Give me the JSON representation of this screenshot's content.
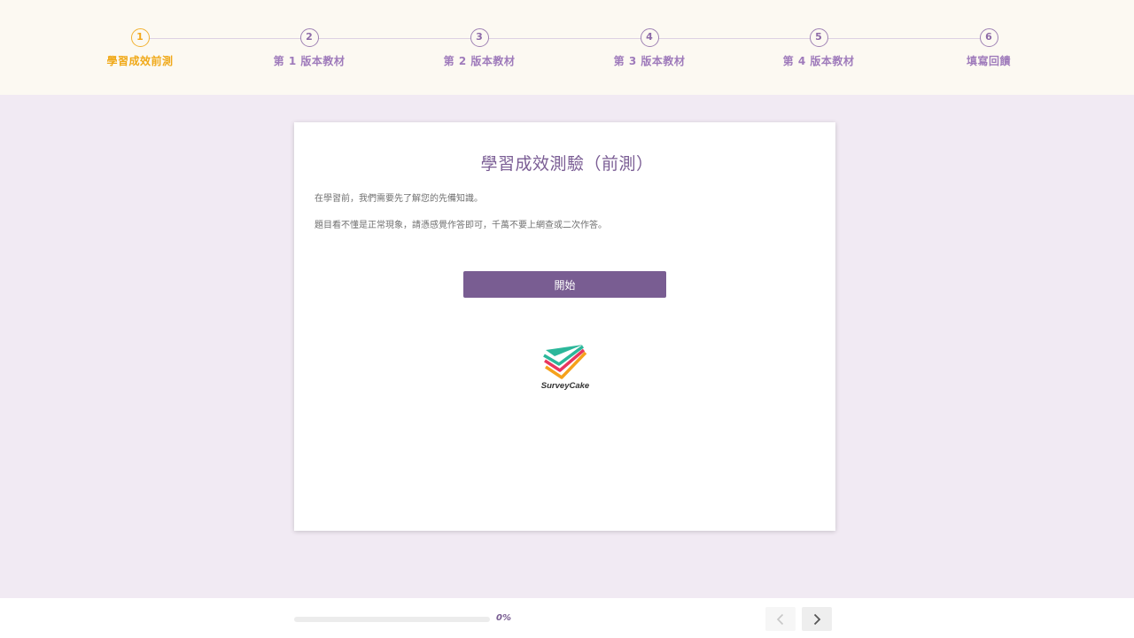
{
  "stepper": {
    "steps": [
      {
        "number": "1",
        "label": "學習成效前測",
        "active": true
      },
      {
        "number": "2",
        "label": "第 1 版本教材",
        "active": false
      },
      {
        "number": "3",
        "label": "第 2 版本教材",
        "active": false
      },
      {
        "number": "4",
        "label": "第 3 版本教材",
        "active": false
      },
      {
        "number": "5",
        "label": "第 4 版本教材",
        "active": false
      },
      {
        "number": "6",
        "label": "填寫回饋",
        "active": false
      }
    ]
  },
  "card": {
    "title": "學習成效測驗（前測）",
    "paragraphs": [
      "在學習前，我們需要先了解您的先備知識。",
      "題目看不懂是正常現象，請憑感覺作答即可，千萬不要上網查或二次作答。"
    ],
    "start_button": "開始",
    "logo_text": "SurveyCake"
  },
  "footer": {
    "progress_percent": 0,
    "progress_text": "0%"
  },
  "colors": {
    "accent": "#795d92",
    "active_step": "#f0a919",
    "background": "#f1eaf3",
    "header_bg": "#fcf9f2"
  }
}
